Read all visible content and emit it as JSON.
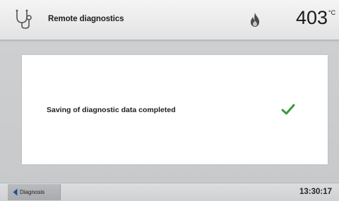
{
  "header": {
    "title": "Remote diagnostics",
    "app_icon": "stethoscope-icon",
    "status_icon": "flame-icon",
    "temperature_value": "403",
    "temperature_unit": "°C"
  },
  "dialog": {
    "message": "Saving of diagnostic data completed",
    "status_icon": "check-icon",
    "status_color": "#3a9a3a"
  },
  "footer": {
    "back_label": "Diagnosis",
    "back_icon": "back-arrow-icon",
    "clock": "13:30:17"
  },
  "colors": {
    "accent_blue": "#1f4fa0",
    "success_green": "#3a9a3a"
  }
}
